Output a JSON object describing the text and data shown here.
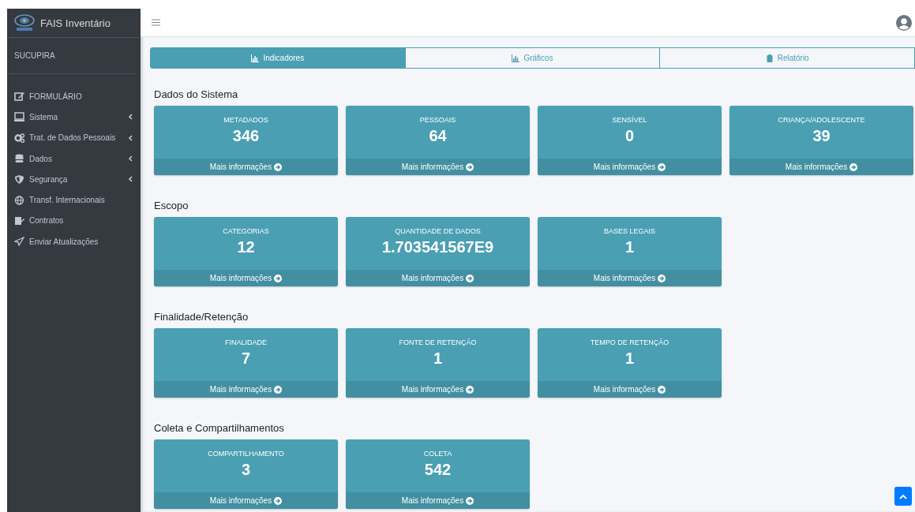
{
  "sidebar": {
    "brand": "FAIS Inventário",
    "section_label": "SUCUPIRA",
    "items": [
      {
        "label": "FORMULÁRIO",
        "kind": "link"
      },
      {
        "label": "Sistema",
        "kind": "submenu"
      },
      {
        "label": "Trat. de Dados Pessoais",
        "kind": "submenu"
      },
      {
        "label": "Dados",
        "kind": "submenu"
      },
      {
        "label": "Segurança",
        "kind": "submenu"
      },
      {
        "label": "Transf. Internacionais",
        "kind": "link"
      },
      {
        "label": "Contratos",
        "kind": "link"
      },
      {
        "label": "Enviar Atualizações",
        "kind": "link"
      }
    ]
  },
  "tabs": [
    {
      "label": "Indicadores",
      "selected": true
    },
    {
      "label": "Gráficos",
      "selected": false
    },
    {
      "label": "Relatório",
      "selected": false
    }
  ],
  "sections": [
    {
      "title": "Dados do Sistema",
      "cards": [
        {
          "label": "METADADOS",
          "value": "346",
          "link": "Mais informações"
        },
        {
          "label": "PESSOAIS",
          "value": "64",
          "link": "Mais informações"
        },
        {
          "label": "SENSÍVEL",
          "value": "0",
          "link": "Mais informações"
        },
        {
          "label": "CRIANÇA/ADOLESCENTE",
          "value": "39",
          "link": "Mais informações"
        }
      ]
    },
    {
      "title": "Escopo",
      "cards": [
        {
          "label": "CATEGORIAS",
          "value": "12",
          "link": "Mais informações"
        },
        {
          "label": "QUANTIDADE DE DADOS",
          "value": "1.703541567E9",
          "link": "Mais informações"
        },
        {
          "label": "BASES LEGAIS",
          "value": "1",
          "link": "Mais informações"
        }
      ]
    },
    {
      "title": "Finalidade/Retenção",
      "cards": [
        {
          "label": "FINALIDADE",
          "value": "7",
          "link": "Mais informações"
        },
        {
          "label": "FONTE DE RETENÇÃO",
          "value": "1",
          "link": "Mais informações"
        },
        {
          "label": "TEMPO DE RETENÇÃO",
          "value": "1",
          "link": "Mais informações"
        }
      ]
    },
    {
      "title": "Coleta e Compartilhamentos",
      "cards": [
        {
          "label": "COMPARTILHAMENTO",
          "value": "3",
          "link": "Mais informações"
        },
        {
          "label": "COLETA",
          "value": "542",
          "link": "Mais informações"
        }
      ]
    }
  ]
}
